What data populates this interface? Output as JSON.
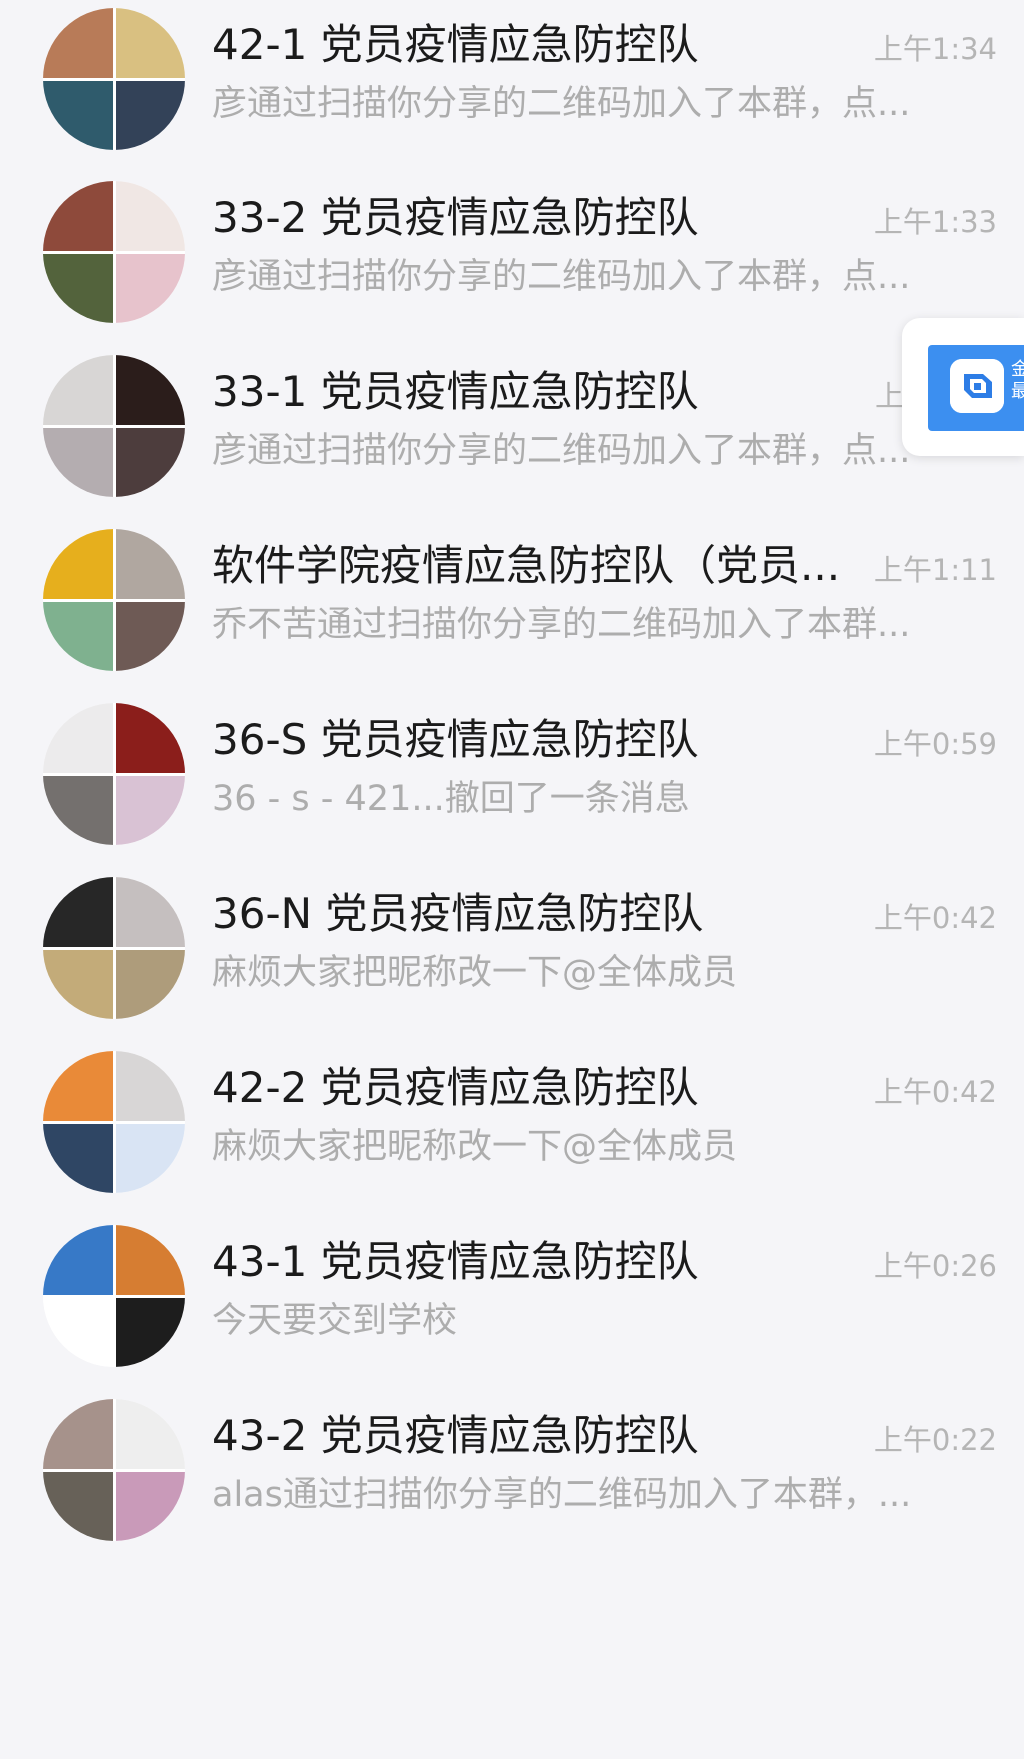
{
  "chats": [
    {
      "name": "42-1 党员疫情应急防控队",
      "time": "上午1:34",
      "preview": "彦通过扫描你分享的二维码加入了本群，点...",
      "avatar_colors": [
        "#b87b58",
        "#d9c081",
        "#2f5b6c",
        "#334258"
      ]
    },
    {
      "name": "33-2 党员疫情应急防控队",
      "time": "上午1:33",
      "preview": "彦通过扫描你分享的二维码加入了本群，点...",
      "avatar_colors": [
        "#8e4a3b",
        "#f0e7e4",
        "#53633c",
        "#e7c3cc"
      ]
    },
    {
      "name": "33-1 党员疫情应急防控队",
      "time": "上",
      "preview": "彦通过扫描你分享的二维码加入了本群，点...",
      "avatar_colors": [
        "#d8d6d5",
        "#2b1d1b",
        "#b4adb0",
        "#4d3d3d"
      ]
    },
    {
      "name": "软件学院疫情应急防控队（党员...",
      "time": "上午1:11",
      "preview": "乔不苦通过扫描你分享的二维码加入了本群...",
      "avatar_colors": [
        "#e6af1d",
        "#b0a7a0",
        "#7fb18f",
        "#6e5a55"
      ]
    },
    {
      "name": "36-S 党员疫情应急防控队",
      "time": "上午0:59",
      "preview": "36 - s - 421...撤回了一条消息",
      "avatar_colors": [
        "#ecebec",
        "#8b1e1b",
        "#74706e",
        "#d9c2d4"
      ]
    },
    {
      "name": "36-N 党员疫情应急防控队",
      "time": "上午0:42",
      "preview": "麻烦大家把昵称改一下@全体成员",
      "avatar_colors": [
        "#272727",
        "#c5bfbf",
        "#c3ab79",
        "#ae9c7b"
      ]
    },
    {
      "name": "42-2 党员疫情应急防控队",
      "time": "上午0:42",
      "preview": "麻烦大家把昵称改一下@全体成员",
      "avatar_colors": [
        "#e98a38",
        "#d8d6d6",
        "#2f4664",
        "#d9e4f4"
      ]
    },
    {
      "name": "43-1  党员疫情应急防控队",
      "time": "上午0:26",
      "preview": "今天要交到学校",
      "avatar_colors": [
        "#3779c7",
        "#d67d32",
        "#ffffff",
        "#1d1d1d"
      ]
    },
    {
      "name": "43-2 党员疫情应急防控队",
      "time": "上午0:22",
      "preview": "alas通过扫描你分享的二维码加入了本群，...",
      "avatar_colors": [
        "#a6928b",
        "#eeeeee",
        "#676158",
        "#c99ab9"
      ]
    }
  ],
  "floating_widget": {
    "icon": "blue-app-icon",
    "text": "金\n最"
  }
}
